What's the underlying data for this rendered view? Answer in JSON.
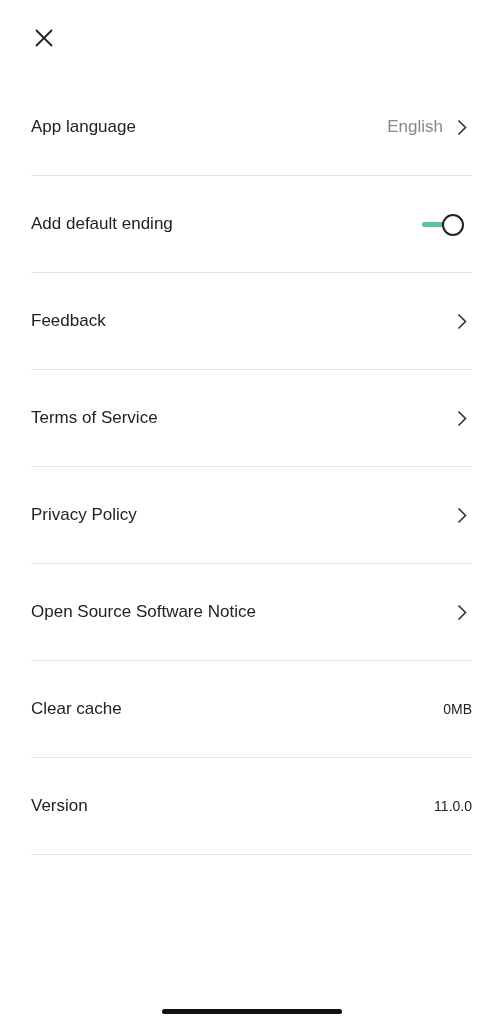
{
  "rows": [
    {
      "kind": "link",
      "label": "App language",
      "value": "English"
    },
    {
      "kind": "toggle",
      "label": "Add default ending",
      "on": true
    },
    {
      "kind": "link",
      "label": "Feedback"
    },
    {
      "kind": "link",
      "label": "Terms of Service"
    },
    {
      "kind": "link",
      "label": "Privacy Policy"
    },
    {
      "kind": "link",
      "label": "Open Source Software Notice"
    },
    {
      "kind": "value",
      "label": "Clear cache",
      "value": "0MB"
    },
    {
      "kind": "value",
      "label": "Version",
      "value": "11.0.0"
    }
  ]
}
